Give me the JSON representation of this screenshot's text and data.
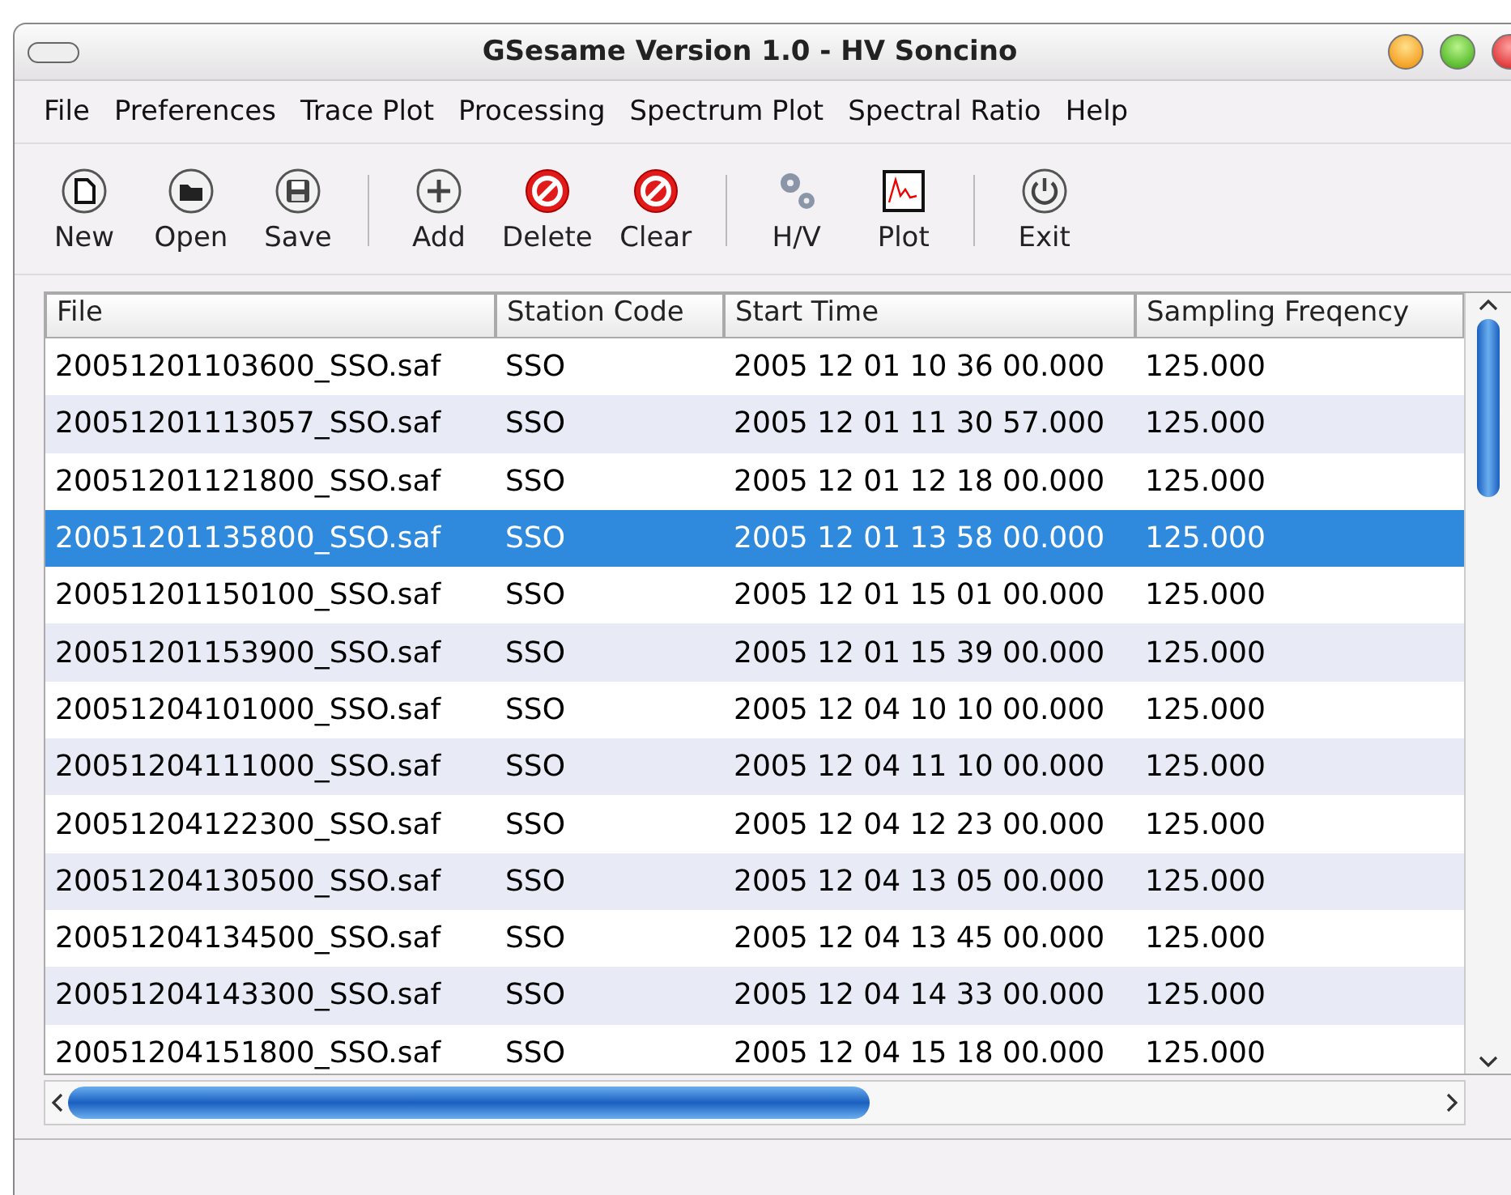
{
  "window": {
    "title": "GSesame Version 1.0 - HV Soncino"
  },
  "menu": [
    "File",
    "Preferences",
    "Trace Plot",
    "Processing",
    "Spectrum Plot",
    "Spectral Ratio",
    "Help"
  ],
  "toolbar": {
    "groups": [
      [
        "New",
        "Open",
        "Save"
      ],
      [
        "Add",
        "Delete",
        "Clear"
      ],
      [
        "H/V",
        "Plot"
      ],
      [
        "Exit"
      ]
    ]
  },
  "table": {
    "columns": [
      "File",
      "Station Code",
      "Start Time",
      "Sampling Freqency"
    ],
    "rows": [
      {
        "cells": [
          "20051201103600_SSO.saf",
          "SSO",
          "2005 12 01 10 36 00.000",
          "125.000"
        ],
        "selected": false
      },
      {
        "cells": [
          "20051201113057_SSO.saf",
          "SSO",
          "2005 12 01 11 30 57.000",
          "125.000"
        ],
        "selected": false
      },
      {
        "cells": [
          "20051201121800_SSO.saf",
          "SSO",
          "2005 12 01 12 18 00.000",
          "125.000"
        ],
        "selected": false
      },
      {
        "cells": [
          "20051201135800_SSO.saf",
          "SSO",
          "2005 12 01 13 58 00.000",
          "125.000"
        ],
        "selected": true
      },
      {
        "cells": [
          "20051201150100_SSO.saf",
          "SSO",
          "2005 12 01 15 01 00.000",
          "125.000"
        ],
        "selected": false
      },
      {
        "cells": [
          "20051201153900_SSO.saf",
          "SSO",
          "2005 12 01 15 39 00.000",
          "125.000"
        ],
        "selected": false
      },
      {
        "cells": [
          "20051204101000_SSO.saf",
          "SSO",
          "2005 12 04 10 10 00.000",
          "125.000"
        ],
        "selected": false
      },
      {
        "cells": [
          "20051204111000_SSO.saf",
          "SSO",
          "2005 12 04 11 10 00.000",
          "125.000"
        ],
        "selected": false
      },
      {
        "cells": [
          "20051204122300_SSO.saf",
          "SSO",
          "2005 12 04 12 23 00.000",
          "125.000"
        ],
        "selected": false
      },
      {
        "cells": [
          "20051204130500_SSO.saf",
          "SSO",
          "2005 12 04 13 05 00.000",
          "125.000"
        ],
        "selected": false
      },
      {
        "cells": [
          "20051204134500_SSO.saf",
          "SSO",
          "2005 12 04 13 45 00.000",
          "125.000"
        ],
        "selected": false
      },
      {
        "cells": [
          "20051204143300_SSO.saf",
          "SSO",
          "2005 12 04 14 33 00.000",
          "125.000"
        ],
        "selected": false
      },
      {
        "cells": [
          "20051204151800_SSO.saf",
          "SSO",
          "2005 12 04 15 18 00.000",
          "125.000"
        ],
        "selected": false
      }
    ]
  }
}
